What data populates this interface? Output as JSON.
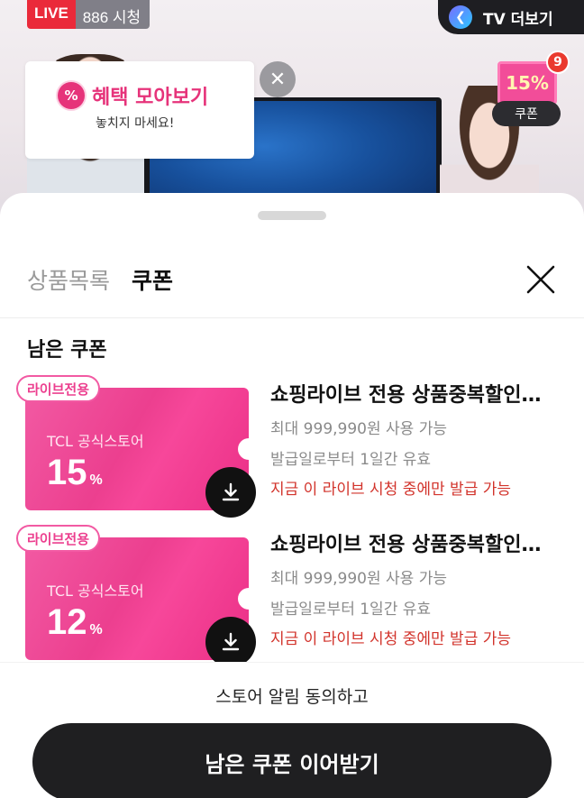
{
  "live": {
    "tag": "LIVE",
    "viewers": "886 시청",
    "tv_more_label": "TV 더보기"
  },
  "benefit": {
    "icon_symbol": "%",
    "title": "혜택 모아보기",
    "subtitle": "놓치지 마세요!",
    "close_symbol": "✕"
  },
  "float_coupon": {
    "percent": "15%",
    "count": "9",
    "label": "쿠폰"
  },
  "sheet": {
    "tabs": [
      {
        "label": "상품목록",
        "active": false
      },
      {
        "label": "쿠폰",
        "active": true
      }
    ],
    "section_title": "남은 쿠폰"
  },
  "coupons": [
    {
      "tag": "라이브전용",
      "store": "TCL 공식스토어",
      "discount": "15",
      "unit": "%",
      "name": "쇼핑라이브 전용 상품중복할인쿠폰",
      "max_discount": "최대 999,990원 사용 가능",
      "validity": "발급일로부터 1일간 유효",
      "condition": "지금 이 라이브 시청 중에만 발급 가능"
    },
    {
      "tag": "라이브전용",
      "store": "TCL 공식스토어",
      "discount": "12",
      "unit": "%",
      "name": "쇼핑라이브 전용 상품중복할인쿠폰",
      "max_discount": "최대 999,990원 사용 가능",
      "validity": "발급일로부터 1일간 유효",
      "condition": "지금 이 라이브 시청 중에만 발급 가능"
    }
  ],
  "footer": {
    "agree_text": "스토어 알림 동의하고",
    "cta_label": "남은 쿠폰 이어받기"
  },
  "colors": {
    "accent_pink": "#ec3f8f",
    "live_red": "#ea2a3a",
    "warn_red": "#d2332b",
    "cta_bg": "#1f1f21"
  }
}
